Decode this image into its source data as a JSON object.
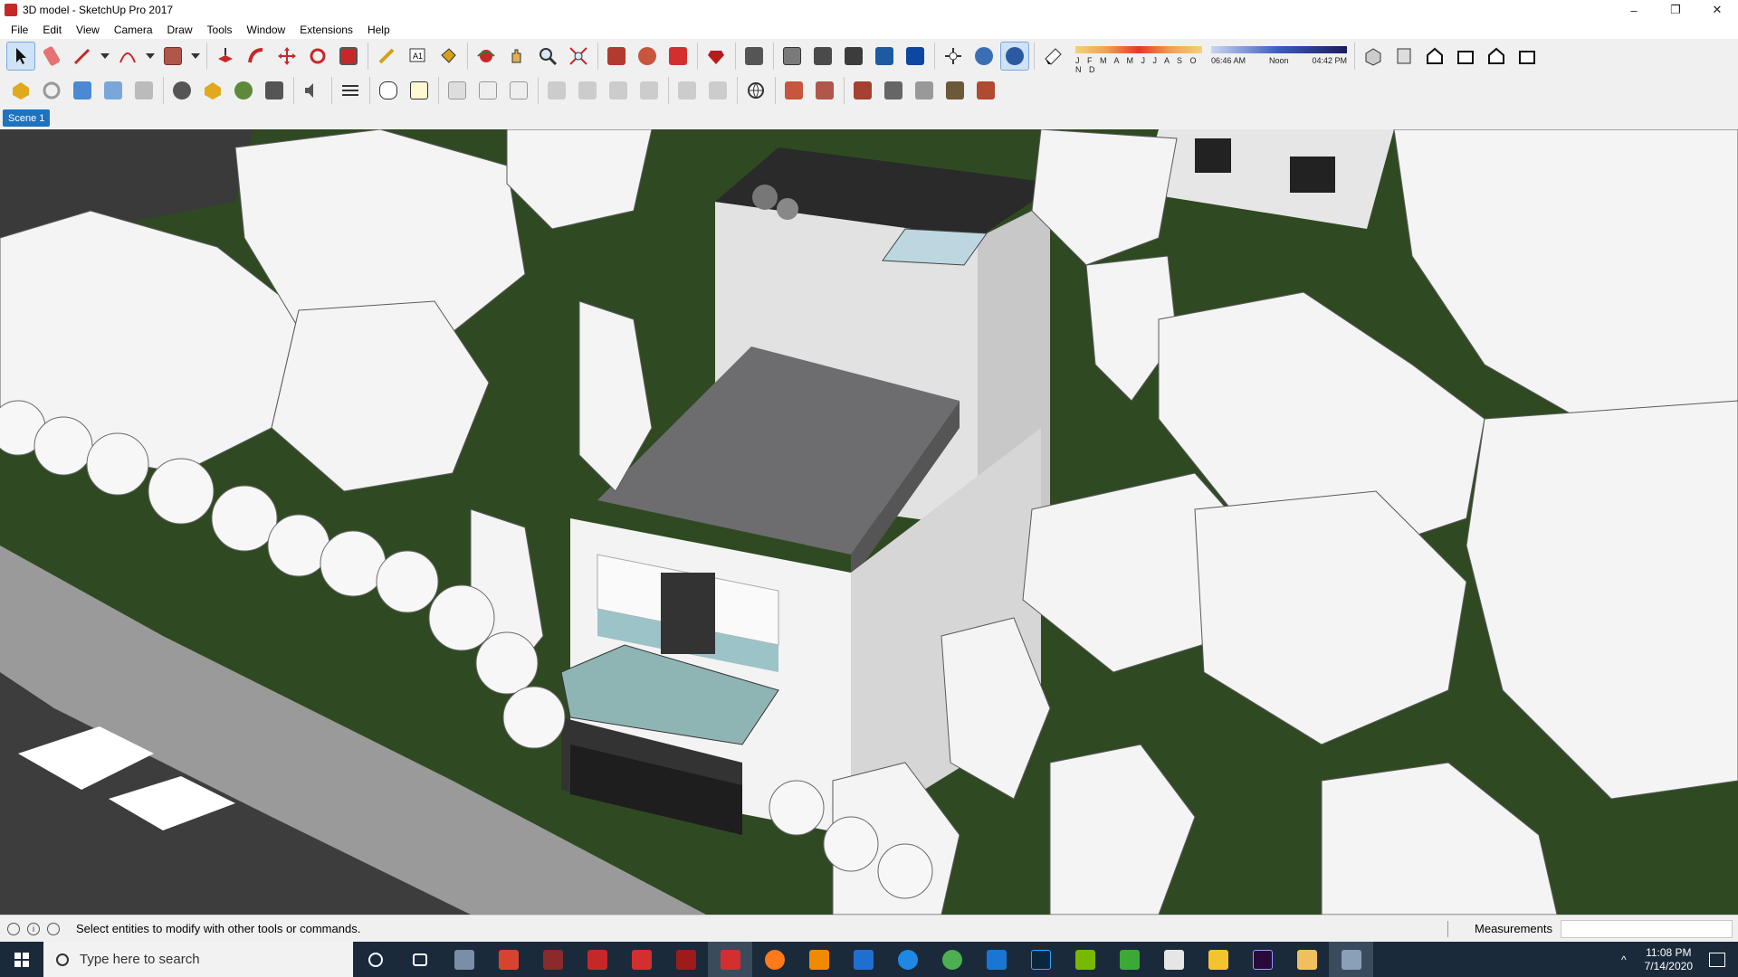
{
  "window": {
    "title": "3D model - SketchUp Pro 2017",
    "controls": {
      "minimize": "–",
      "restore": "❐",
      "close": "✕"
    }
  },
  "menu": [
    "File",
    "Edit",
    "View",
    "Camera",
    "Draw",
    "Tools",
    "Window",
    "Extensions",
    "Help"
  ],
  "toolbar": {
    "row1_icons": [
      "select-icon",
      "eraser-icon",
      "pencil-line-icon",
      "dropdown-icon",
      "arc-icon",
      "dropdown-icon",
      "rectangle-icon",
      "dropdown-icon",
      "push-pull-icon",
      "follow-me-icon",
      "move-icon",
      "rotate-icon",
      "scale-icon",
      "tape-measure-icon",
      "text-icon",
      "paint-bucket-icon",
      "orbit-icon",
      "pan-icon",
      "zoom-icon",
      "zoom-extents-icon",
      "warehouse-icon",
      "extension-warehouse-icon",
      "send-to-layout-icon",
      "ruby-icon",
      "component-icon",
      "x-ray-icon",
      "back-edges-icon",
      "wireframe-icon",
      "hidden-line-icon",
      "shaded-icon",
      "position-camera-icon",
      "walk-icon",
      "look-around-icon",
      "section-plane-icon"
    ],
    "row2_icons": [
      "sandbox-icon",
      "smoove-icon",
      "stamp-icon",
      "drape-icon",
      "camera-icon",
      "add-location-icon",
      "geo-icon",
      "tree-icon",
      "settings-icon",
      "sound-icon",
      "styles-icon",
      "chat-icon",
      "info-icon",
      "layout-icon",
      "export-icon",
      "import-icon",
      "view-1-icon",
      "view-2-icon",
      "view-3-icon",
      "view-4-icon",
      "view-5-icon",
      "view-6-icon",
      "globe-icon",
      "texture-icon",
      "grid-icon",
      "solid-1-icon",
      "solid-2-icon",
      "solid-3-icon",
      "solid-4-icon",
      "solid-5-icon"
    ],
    "right_icons": [
      "iso-view-icon",
      "top-view-icon",
      "front-view-icon",
      "right-view-icon",
      "back-view-icon",
      "left-view-icon"
    ],
    "shadow": {
      "months": "J F M A M J J A S O N D",
      "time_start": "06:46 AM",
      "time_mid": "Noon",
      "time_end": "04:42 PM"
    }
  },
  "scene_tabs": [
    "Scene 1"
  ],
  "status": {
    "message": "Select entities to modify with other tools or commands.",
    "measurements_label": "Measurements",
    "measurements_value": ""
  },
  "taskbar": {
    "search_placeholder": "Type here to search",
    "apps": [
      "cortana-icon",
      "task-view-icon",
      "camera-app-icon",
      "corel-icon",
      "media-icon",
      "folder-red-icon",
      "autocad-icon",
      "red-app-icon",
      "sketchup-icon",
      "firefox-icon",
      "vlc-icon",
      "malwarebytes-icon",
      "edge-icon",
      "chrome-icon",
      "mail-icon",
      "photoshop-icon",
      "nvidia-icon",
      "camtasia-icon",
      "store-icon",
      "file-explorer-icon",
      "premiere-icon",
      "video-app-icon",
      "settings-app-icon"
    ],
    "time": "11:08 PM",
    "date": "7/14/2020"
  },
  "colors": {
    "accent": "#1e73be",
    "taskbar": "#1b2a3a",
    "grass": "#2f4a22"
  }
}
